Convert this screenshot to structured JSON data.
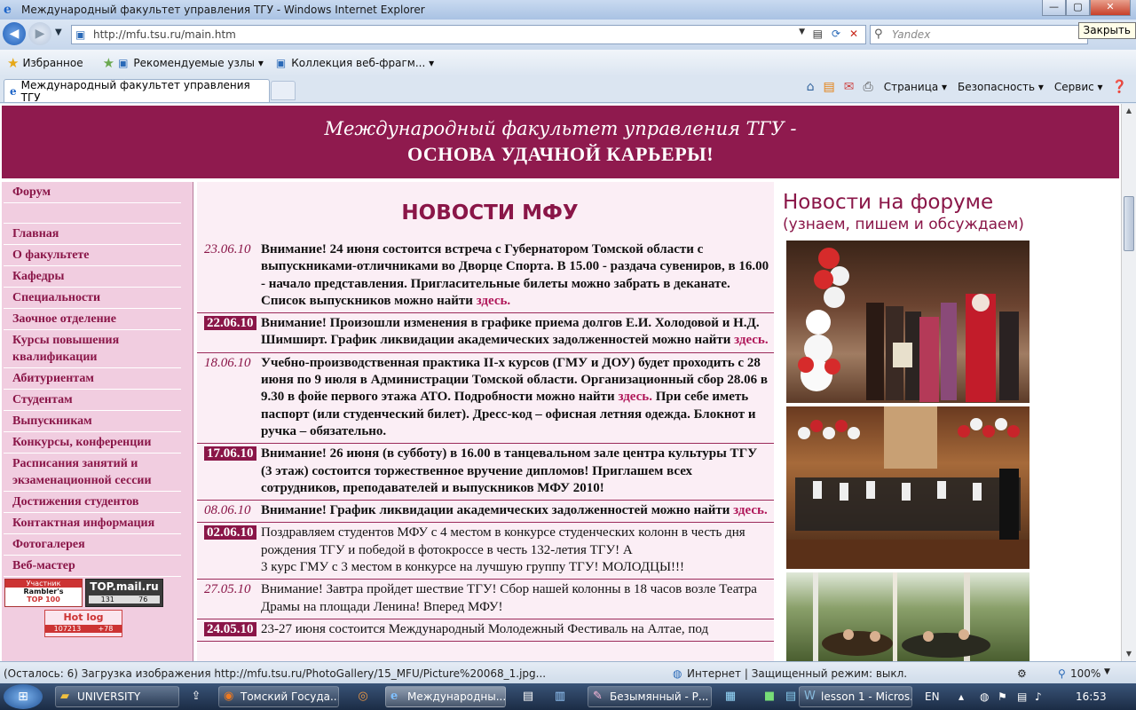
{
  "window": {
    "title": "Международный факультет управления ТГУ - Windows Internet Explorer",
    "btn_min": "—",
    "btn_max": "▢",
    "btn_close": "✕",
    "close_tooltip": "Закрыть"
  },
  "toolbar": {
    "back": "◀",
    "forward": "▶",
    "url": "http://mfu.tsu.ru/main.htm",
    "search_placeholder": "Yandex"
  },
  "favorites": {
    "label": "Избранное",
    "item1": "Рекомендуемые узлы ▾",
    "item2": "Коллекция веб-фрагм... ▾"
  },
  "tab": {
    "label": "Международный факультет управления ТГУ"
  },
  "commandbar": {
    "page": "Страница ▾",
    "safety": "Безопасность ▾",
    "service": "Сервис ▾"
  },
  "banner": {
    "line1": "Международный факультет управления ТГУ -",
    "line2": "ОСНОВА УДАЧНОЙ КАРЬЕРЫ!"
  },
  "sidebar": {
    "items": [
      "Форум",
      "",
      "Главная",
      "О факультете",
      "Кафедры",
      "Специальности",
      "Заочное отделение",
      "Курсы повышения квалификации",
      "Абитуриентам",
      "Студентам",
      "Выпускникам",
      "Конкурсы, конференции",
      "Расписания занятий и экзаменационной сессии",
      "Достижения студентов",
      "Контактная информация",
      "Фотогалерея",
      "Веб-мастер"
    ],
    "counters": {
      "rambler_l1": "Участник",
      "rambler_l2": "Rambler's",
      "rambler_l3": "TOP 100",
      "mail_title": "TOP.mail.ru",
      "mail_v1": "131",
      "mail_v2": "76",
      "hotlog_title": "Hot log",
      "hotlog_v1": "107213",
      "hotlog_v2": "+78"
    }
  },
  "news": {
    "title": "НОВОСТИ МФУ",
    "link_word": "здесь.",
    "items": [
      {
        "date": "23.06.10",
        "text": "Внимание! 24 июня состоится встреча с Губернатором Томской области  с выпускниками-отличниками  во Дворце Спорта. В 15.00 - раздача сувениров, в 16.00 - начало представления. Пригласительные билеты можно забрать в деканате. Список выпускников можно найти"
      },
      {
        "date": "22.06.10",
        "text": "Внимание! Произошли изменения в графике приема долгов Е.И. Холодовой и Н.Д. Шимширт. График ликвидации академических задолженностей можно найти"
      },
      {
        "date": "18.06.10",
        "text": "Учебно-производственная практика II-х курсов (ГМУ и ДОУ) будет проходить с 28 июня по 9 июля в Администрации Томской области. Организационный сбор 28.06 в 9.30 в фойе первого этажа АТО. Подробности можно найти",
        "text_after": "При себе иметь паспорт (или студенческий билет). Дресс-код – офисная летняя одежда. Блокнот и ручка – обязательно."
      },
      {
        "date": "17.06.10",
        "text": "Внимание! 26 июня (в субботу) в 16.00 в танцевальном зале центра культуры ТГУ (3 этаж) состоится торжественное вручение дипломов! Приглашем всех сотрудников, преподавателей и выпускников МФУ 2010!"
      },
      {
        "date": "08.06.10",
        "text": "Внимание! График ликвидации академических задолженностей можно найти"
      },
      {
        "date": "02.06.10",
        "text": "Поздравляем студентов МФУ с 4 местом в конкурсе студенческих колонн в честь дня рождения ТГУ и  победой в фотокроссе в честь 132-летия ТГУ! А",
        "text_after": "3 курс ГМУ с 3 местом в конкурсе на лучшую группу ТГУ! МОЛОДЦЫ!!!"
      },
      {
        "date": "27.05.10",
        "text": "Внимание! Завтра пройдет шествие ТГУ! Сбор нашей колонны в 18 часов возле Театра Драмы на площади Ленина! Вперед МФУ!"
      },
      {
        "date": "24.05.10",
        "text": "23-27 июня состоится Международный Молодежный Фестиваль на Алтае, под"
      }
    ]
  },
  "forum": {
    "title": "Новости на форуме",
    "subtitle": "(узнаем, пишем и обсуждаем)"
  },
  "statusbar": {
    "loading": "(Осталось: 6) Загрузка изображения http://mfu.tsu.ru/PhotoGallery/15_MFU/Picture%20068_1.jpg...",
    "zone": "Интернет | Защищенный режим: выкл.",
    "zoom": "100%"
  },
  "taskbar": {
    "start": "⊞",
    "btn1": "UNIVERSITY",
    "btn2": "Томский Госуда...",
    "btn3": "Международны...",
    "btn4": "Безымянный - Р...",
    "btn5": "lesson 1 - Micros...",
    "lang": "EN",
    "time": "16:53"
  }
}
